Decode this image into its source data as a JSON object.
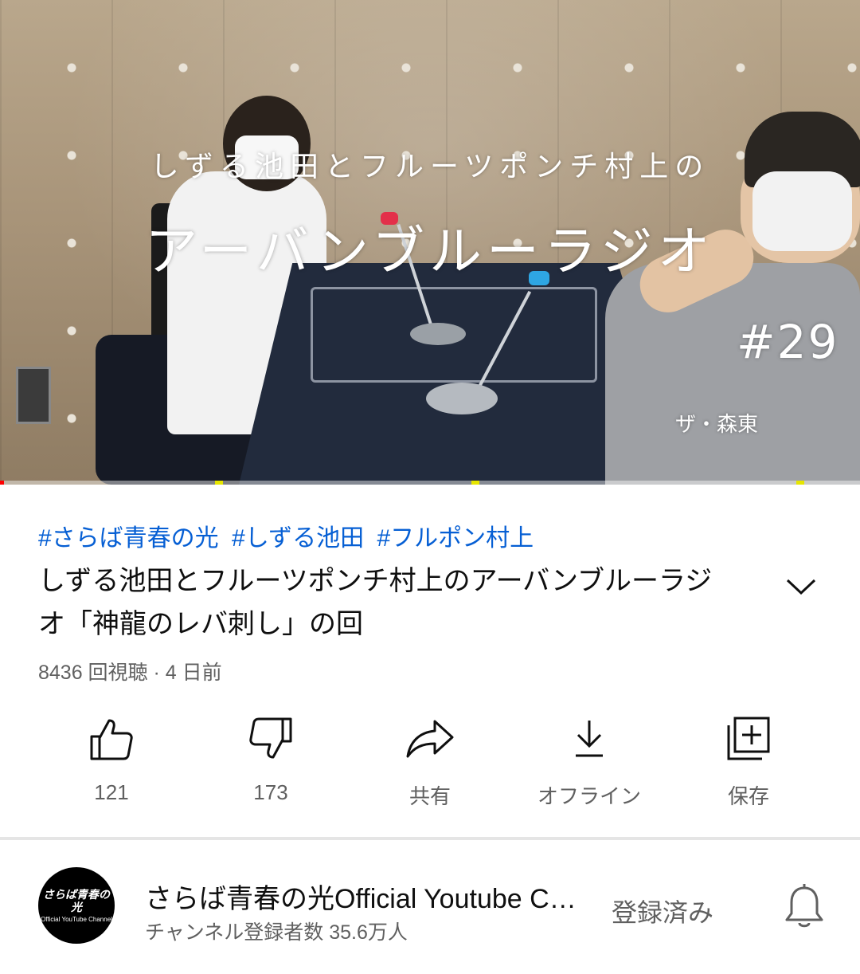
{
  "player": {
    "overlay_subtitle": "しずる池田とフルーツポンチ村上の",
    "overlay_title": "アーバンブルーラジオ",
    "overlay_episode": "#29",
    "overlay_signature": "ザ・森東",
    "progress_fraction": 0.005
  },
  "video": {
    "hashtags": [
      "#さらば青春の光",
      "#しずる池田",
      "#フルポン村上"
    ],
    "title": "しずる池田とフルーツポンチ村上のアーバンブルーラジオ「神龍のレバ刺し」の回",
    "meta": "8436 回視聴 · 4 日前"
  },
  "actions": {
    "like": {
      "label": "121",
      "icon": "thumbs-up-icon"
    },
    "dislike": {
      "label": "173",
      "icon": "thumbs-down-icon"
    },
    "share": {
      "label": "共有",
      "icon": "share-icon"
    },
    "offline": {
      "label": "オフライン",
      "icon": "download-icon"
    },
    "save": {
      "label": "保存",
      "icon": "add-to-playlist-icon"
    }
  },
  "channel": {
    "avatar_text": "さらば青春の光",
    "avatar_subtext": "Official YouTube Channel",
    "name": "さらば青春の光Official Youtube Channel",
    "subscribers": "チャンネル登録者数 35.6万人",
    "subscribe_state": "登録済み",
    "bell_icon": "bell-icon"
  },
  "colors": {
    "hashtag": "#065fd4",
    "secondary_text": "#606060",
    "progress": "#ff0000"
  }
}
